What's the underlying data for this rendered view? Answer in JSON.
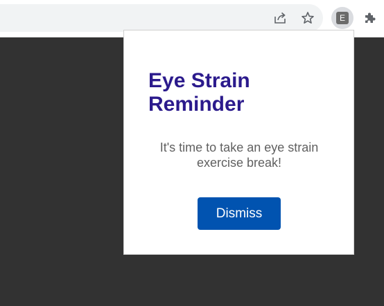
{
  "toolbar": {
    "icons": [
      "share-icon",
      "star-icon",
      "extension-e-icon",
      "puzzle-icon"
    ],
    "extension_badge_letter": "E"
  },
  "popup": {
    "title": "Eye Strain Reminder",
    "message": "It's time to take an eye strain exercise break!",
    "dismiss_label": "Dismiss"
  },
  "colors": {
    "page_background": "#323232",
    "toolbar_background": "#ffffff",
    "omnibox_background": "#f1f3f4",
    "title": "#2b1a8c",
    "message": "#606060",
    "button": "#0153b0",
    "icon": "#5f6368"
  }
}
